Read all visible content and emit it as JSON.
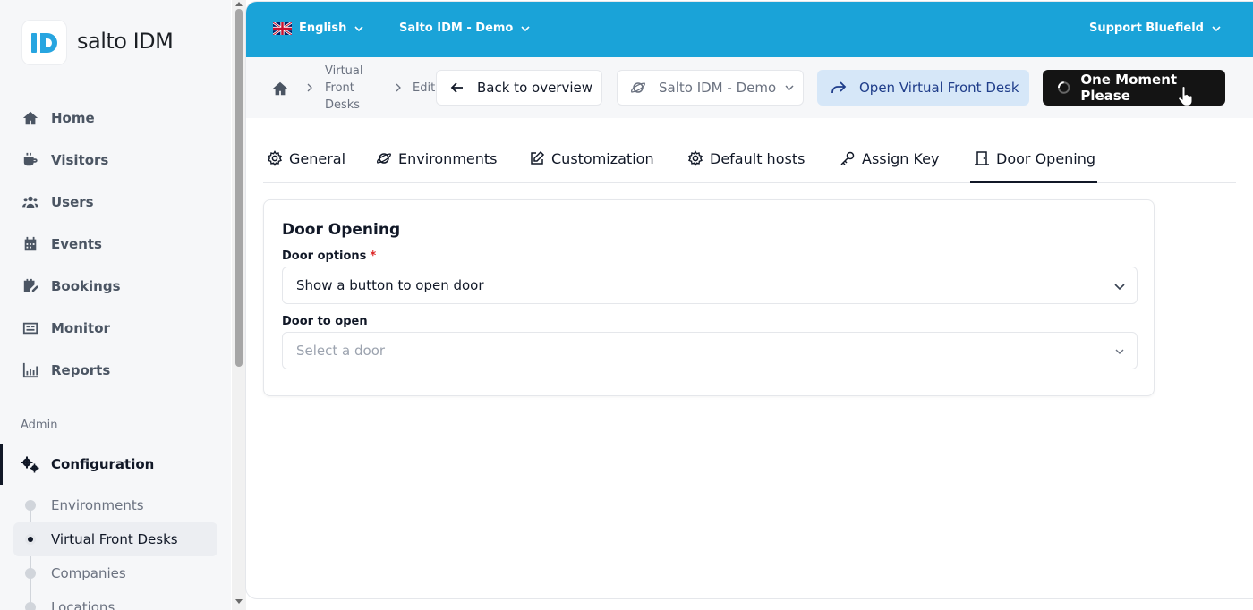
{
  "brand": {
    "logo_letters": "ID",
    "name": "salto IDM"
  },
  "sidebar": {
    "items": [
      {
        "label": "Home",
        "icon": "home-icon"
      },
      {
        "label": "Visitors",
        "icon": "coffee-icon"
      },
      {
        "label": "Users",
        "icon": "users-icon"
      },
      {
        "label": "Events",
        "icon": "calendar-icon"
      },
      {
        "label": "Bookings",
        "icon": "bookings-icon"
      },
      {
        "label": "Monitor",
        "icon": "monitor-icon"
      },
      {
        "label": "Reports",
        "icon": "reports-icon"
      }
    ],
    "section_label": "Admin",
    "configuration": {
      "label": "Configuration",
      "icon": "gears-icon"
    },
    "sub_items": [
      {
        "label": "Environments",
        "active": false
      },
      {
        "label": "Virtual Front Desks",
        "active": true
      },
      {
        "label": "Companies",
        "active": false
      },
      {
        "label": "Locations",
        "active": false
      }
    ]
  },
  "topbar": {
    "language": "English",
    "tenant": "Salto IDM - Demo",
    "user": "Support Bluefield",
    "color": "#1aa3d8"
  },
  "breadcrumb": {
    "items": [
      "Virtual",
      "Front",
      "Desks"
    ],
    "current": "Edit"
  },
  "actions": {
    "back_label": "Back to overview",
    "environment_label": "Salto IDM - Demo",
    "open_vfd_label": "Open Virtual Front Desk",
    "loading_label": "One Moment Please"
  },
  "tabs": [
    {
      "label": "General",
      "icon": "gear-icon"
    },
    {
      "label": "Environments",
      "icon": "planet-icon"
    },
    {
      "label": "Customization",
      "icon": "edit-icon"
    },
    {
      "label": "Default hosts",
      "icon": "gear-icon"
    },
    {
      "label": "Assign Key",
      "icon": "key-icon"
    },
    {
      "label": "Door Opening",
      "icon": "door-icon",
      "active": true
    }
  ],
  "card": {
    "title": "Door Opening",
    "door_options_label": "Door options",
    "required_mark": "*",
    "door_options_value": "Show a button to open door",
    "door_to_open_label": "Door to open",
    "door_to_open_placeholder": "Select a door"
  }
}
